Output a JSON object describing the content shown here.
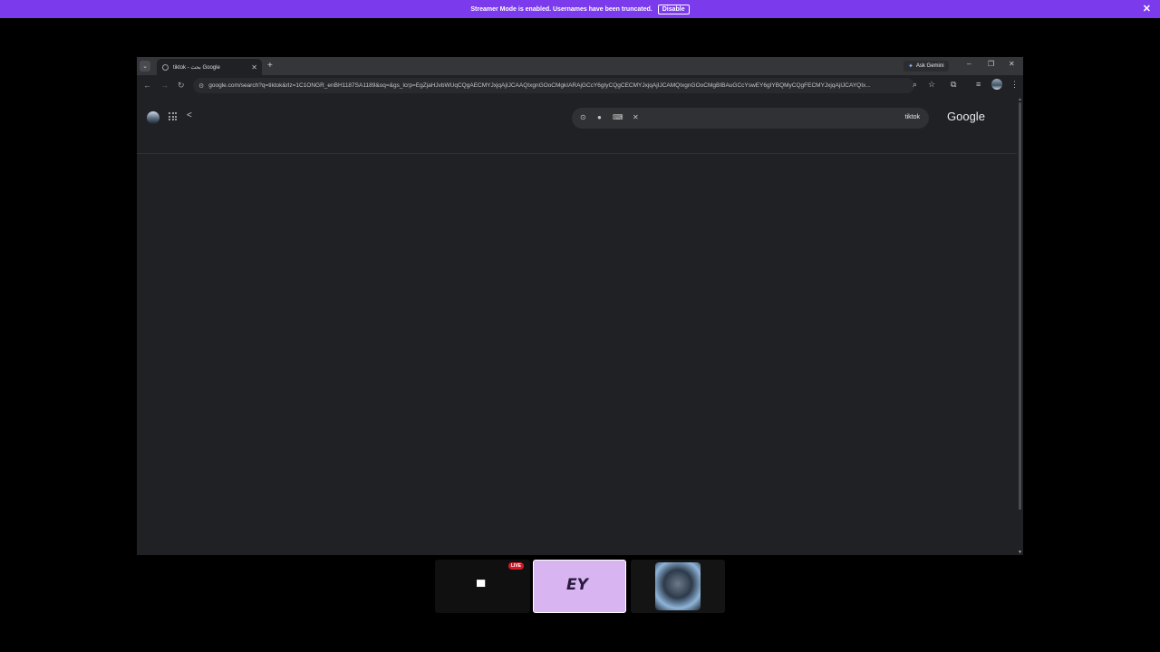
{
  "banner": {
    "message": "Streamer Mode is enabled. Usernames have been truncated.",
    "disable_label": "Disable",
    "close_glyph": "✕"
  },
  "browser": {
    "tab": {
      "title": "tiktok - بحث Google",
      "close_glyph": "✕"
    },
    "new_tab_glyph": "+",
    "ask_gemini_label": "Ask Gemini",
    "window_controls": {
      "minimize": "–",
      "restore": "❐",
      "close": "✕"
    },
    "nav": {
      "back": "←",
      "forward": "→",
      "reload": "↻"
    },
    "url": "google.com/search?q=tiktok&rlz=1C1ONGR_enBH1187SA1189&oq=&gs_lcrp=EgZjaHJvbWUqCQgAECMYJxjqAjIJCAAQIxgnGOoCMgkIARAjGCcY6gIyCQgCECMYJxjqAjIJCAMQIxgnGOoCMgBIBAuGCcYswEY6gIYBQMyCQgFECMYJxjqAjIJCAYQIx...",
    "page": {
      "search_query": "tiktok",
      "logo_text": "Google"
    }
  },
  "stream_bar": {
    "live_badge": "LIVE",
    "brand_logo_text": "EY"
  },
  "colors": {
    "banner": "#7c3aed",
    "page_bg": "#202124",
    "search_bg": "#303134",
    "live_red": "#d11a2a",
    "brand_tile": "#d8b4f0"
  },
  "icons": [
    "search-icon",
    "mic-icon",
    "lens-icon",
    "keyboard-icon",
    "clear-icon",
    "apps-icon",
    "share-icon",
    "star-icon",
    "extensions-icon",
    "menu-icon",
    "monitor-icon"
  ]
}
